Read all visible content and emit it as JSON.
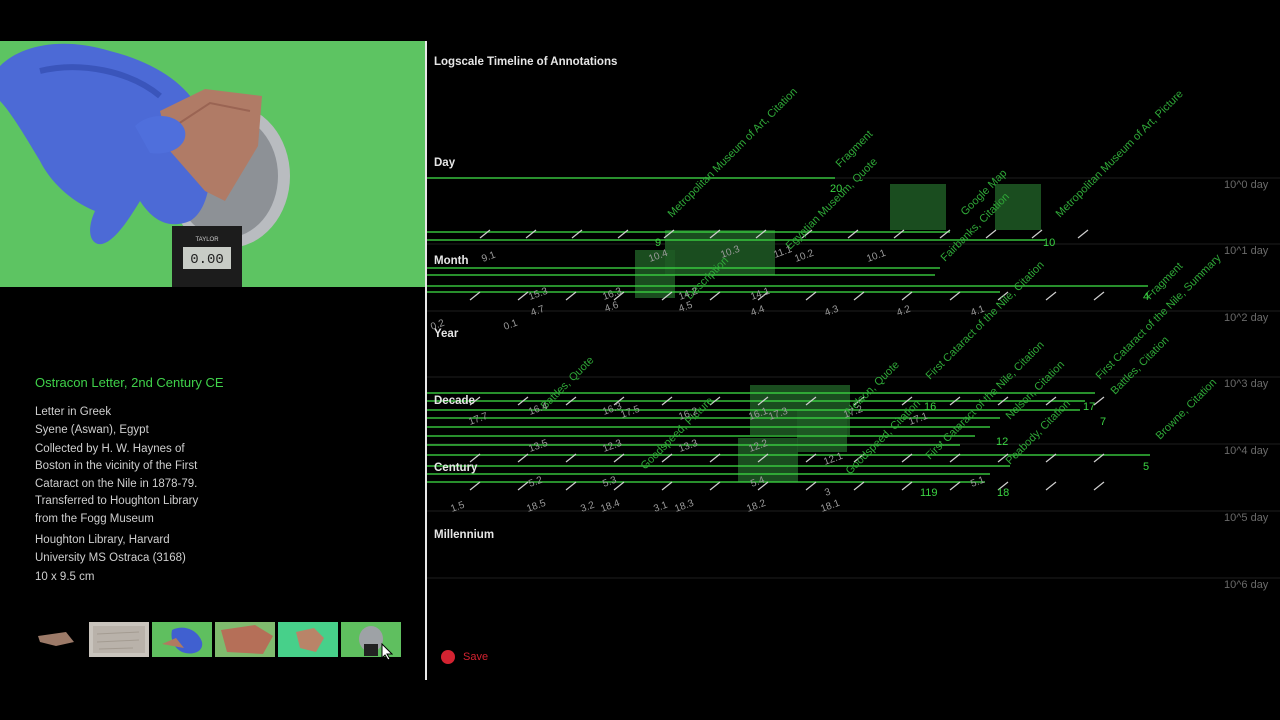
{
  "info": {
    "title": "Ostracon Letter, 2nd Century CE",
    "lines": [
      "Letter in Greek",
      "Syene (Aswan), Egypt",
      "Collected by H. W. Haynes of",
      "Boston in the vicinity of the First",
      "Cataract on the Nile in 1878-79.",
      "Transferred to Houghton Library",
      "from the Fogg Museum",
      "Houghton Library, Harvard",
      "University MS Ostraca (3168)",
      "10 x 9.5 cm"
    ]
  },
  "video": {
    "scale_brand": "TAYLOR",
    "scale_display": "0.00"
  },
  "thumbnails": [
    {
      "name": "thumb-ostracon-dark"
    },
    {
      "name": "thumb-ostracon-texture"
    },
    {
      "name": "thumb-gloved-hand"
    },
    {
      "name": "thumb-ostracon-closeup"
    },
    {
      "name": "thumb-ostracon-green"
    },
    {
      "name": "thumb-scale-weighing"
    }
  ],
  "timeline": {
    "title": "Logscale Timeline of Annotations",
    "scales": [
      "Day",
      "Month",
      "Year",
      "Decade",
      "Century",
      "Millennium"
    ],
    "log_labels": [
      "10^0 day",
      "10^1 day",
      "10^2 day",
      "10^3 day",
      "10^4 day",
      "10^5 day",
      "10^6 day"
    ],
    "annotations": [
      {
        "text": "Metropolitan Museum of Art, Citation"
      },
      {
        "text": "Fragment"
      },
      {
        "text": "Egyptian Museum, Quote"
      },
      {
        "text": "Google Map"
      },
      {
        "text": "Fairbanks, Citation"
      },
      {
        "text": "Metropolitan Museum of Art, Picture"
      },
      {
        "text": "Description"
      },
      {
        "text": "Fragment"
      },
      {
        "text": "First Cataract of the Nile, Citation"
      },
      {
        "text": "First Cataract of the Nile, Summary"
      },
      {
        "text": "Battles, Quote"
      },
      {
        "text": "Nelson, Quote"
      },
      {
        "text": "Nelson, Citation"
      },
      {
        "text": "First Cataract of the Nile, Citation"
      },
      {
        "text": "Battles, Citation"
      },
      {
        "text": "Goodspeed, Picture"
      },
      {
        "text": "Peabody, Citation"
      },
      {
        "text": "Browne, Citation"
      },
      {
        "text": "Goodspeed, Citation"
      }
    ],
    "numbers": [
      "20",
      "9",
      "10",
      "10.4",
      "10.3",
      "10.2",
      "10.1",
      "11.1",
      "9.1",
      "16.3",
      "15.3",
      "14.2",
      "14.1",
      "4.5",
      "4.6",
      "4.7",
      "4.4",
      "4.3",
      "4.2",
      "4.1",
      "4",
      "0.2",
      "0.1",
      "17.7",
      "16.4",
      "16.3",
      "17.5",
      "16.2",
      "16.1",
      "17.3",
      "17.2",
      "17.1",
      "16",
      "17",
      "7",
      "13.5",
      "12.3",
      "13.3",
      "12.2",
      "12.1",
      "12",
      "5",
      "5.2",
      "5.3",
      "5.4",
      "5.1",
      "119",
      "18",
      "3",
      "1.5",
      "18.5",
      "3.2",
      "18.4",
      "3.1",
      "18.3",
      "18.2",
      "18.1"
    ]
  },
  "save": {
    "label": "Save"
  }
}
